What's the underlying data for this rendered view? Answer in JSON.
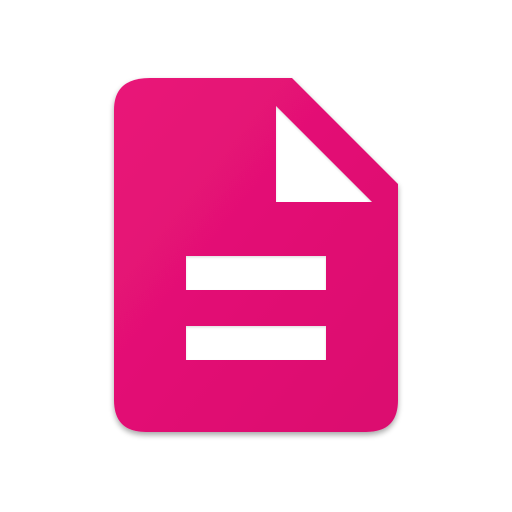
{
  "icon": {
    "name": "document-icon",
    "colors": {
      "body": "#e8127a",
      "body_gradient_start": "#e91578",
      "body_gradient_end": "#db0b6f",
      "cutout": "#ffffff",
      "background": "#ffffff",
      "shadow": "rgba(0,0,0,0.28)"
    }
  }
}
